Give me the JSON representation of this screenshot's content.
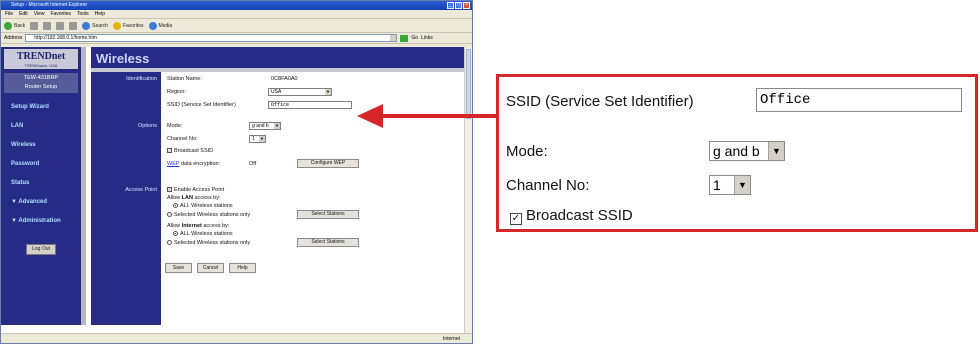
{
  "browser": {
    "title": "Setup - Microsoft Internet Explorer",
    "menu": [
      "File",
      "Edit",
      "View",
      "Favorites",
      "Tools",
      "Help"
    ],
    "toolbar": {
      "back": "Back",
      "search": "Search",
      "favorites": "Favorites",
      "media": "Media"
    },
    "address_label": "Address",
    "address_value": "http://192.168.0.1/home.htm",
    "go_label": "Go",
    "links_label": "Links",
    "status_zone": "Internet"
  },
  "sidebar": {
    "logo": "TRENDnet",
    "logo_sub": "TRENDware, USA",
    "model_line1": "TEW-431BRP",
    "model_line2": "Router Setup",
    "items": [
      "Setup Wizard",
      "LAN",
      "Wireless",
      "Password",
      "Status",
      "▼ Advanced",
      "▼ Administration"
    ],
    "logout": "Log Out"
  },
  "page": {
    "title": "Wireless",
    "sections": {
      "identification": "Identification",
      "options": "Options",
      "access_point": "Access Point"
    },
    "station_name_label": "Station Name:",
    "station_name_value": "0C8FA0A0",
    "region_label": "Region:",
    "region_value": "USA",
    "ssid_label": "SSID (Service Set Identifier)",
    "ssid_value": "Office",
    "mode_label": "Mode:",
    "mode_value": "g and b",
    "channel_label": "Channel No:",
    "channel_value": "1",
    "broadcast_label": "Broadcast SSID",
    "wep_link": "WEP",
    "wep_label": " data encryption:",
    "wep_value": "Off",
    "configure_wep": "Configure WEP",
    "enable_ap": "Enable Access Point",
    "allow_lan_prefix": "Allow ",
    "allow_lan_bold": "LAN",
    "allow_lan_suffix": " access by:",
    "all_wireless": "ALL Wireless stations",
    "selected_wireless": "Selected Wireless stations only",
    "select_stations": "Select Stations",
    "allow_inet_prefix": "Allow ",
    "allow_inet_bold": "Internet",
    "allow_inet_suffix": " access by:",
    "save": "Save",
    "cancel": "Cancel",
    "help": "Help"
  },
  "zoom": {
    "ssid_label": "SSID (Service Set Identifier)",
    "ssid_value": "Office",
    "mode_label": "Mode:",
    "mode_value": "g and b",
    "channel_label": "Channel No:",
    "channel_value": "1",
    "broadcast_label": "Broadcast SSID"
  },
  "colors": {
    "nav": "#262c86",
    "callout": "#d7262a",
    "link": "#aee0ff"
  },
  "icons": [
    "back-icon",
    "forward-icon",
    "go-icon",
    "arrow-icon",
    "checkbox-icon",
    "dropdown-arrow-icon"
  ]
}
